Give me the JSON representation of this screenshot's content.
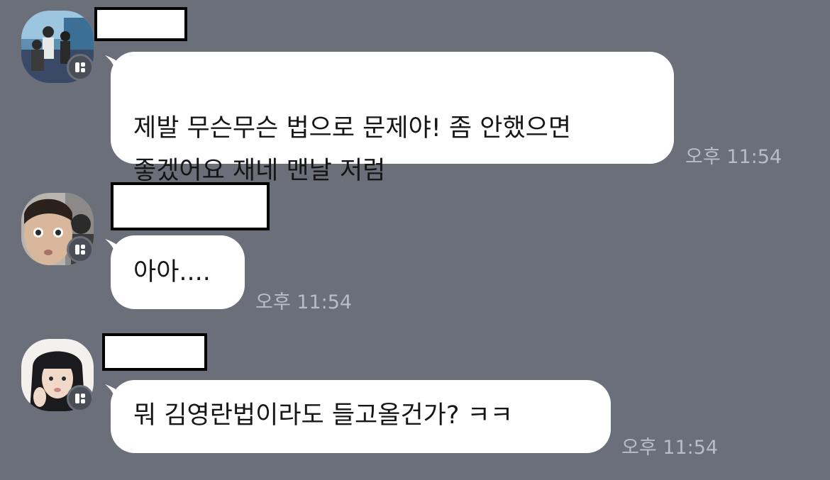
{
  "messages": [
    {
      "text": "제발 무슨무슨 법으로 문제야! 좀 안했으면\n좋겠어요 재네 맨날 저럼",
      "time": "오후 11:54"
    },
    {
      "text": "아아....",
      "time": "오후 11:54"
    },
    {
      "text": "뭐 김영란법이라도 들고올건가? ㅋㅋ",
      "time": "오후 11:54"
    }
  ],
  "colors": {
    "background": "#6b6f79",
    "bubble": "#ffffff",
    "timestamp": "#b8bcc4",
    "badge": "#4a4e57"
  },
  "icons": {
    "badge": "chat-badge-icon"
  }
}
